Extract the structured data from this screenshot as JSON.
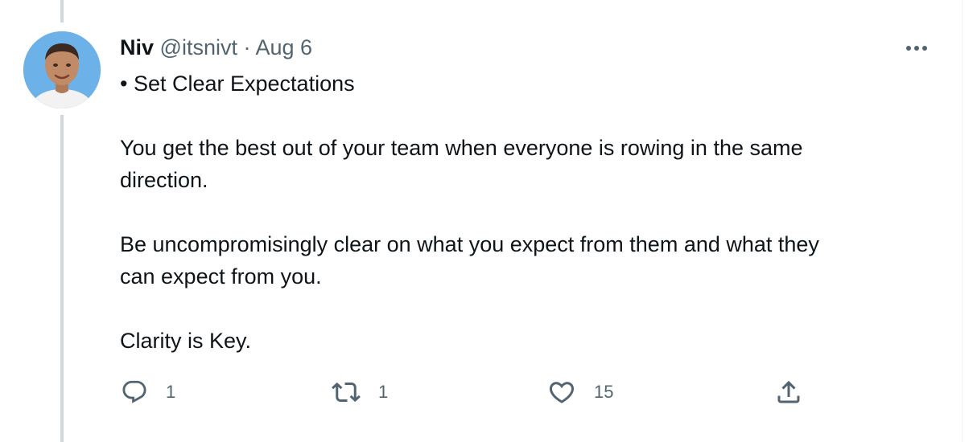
{
  "tweet": {
    "author": {
      "name": "Niv",
      "handle": "@itsnivt",
      "separator": "·",
      "date": "Aug 6"
    },
    "paragraphs": [
      [
        "• Set Clear Expectations"
      ],
      [
        "You get the best out of your team when everyone is rowing in the same",
        "direction."
      ],
      [
        "Be uncompromisingly clear on what you expect from them and what they",
        "can expect from you."
      ],
      [
        "Clarity is Key."
      ]
    ],
    "actions": {
      "replies": "1",
      "retweets": "1",
      "likes": "15"
    }
  },
  "icons": {
    "more": "more-horizontal-icon",
    "reply": "reply-icon",
    "retweet": "retweet-icon",
    "like": "heart-icon",
    "share": "share-icon"
  },
  "colors": {
    "text_primary": "#0f1419",
    "text_secondary": "#536471",
    "thread_line": "#cfd9de",
    "avatar_background": "#6cb2e8"
  }
}
